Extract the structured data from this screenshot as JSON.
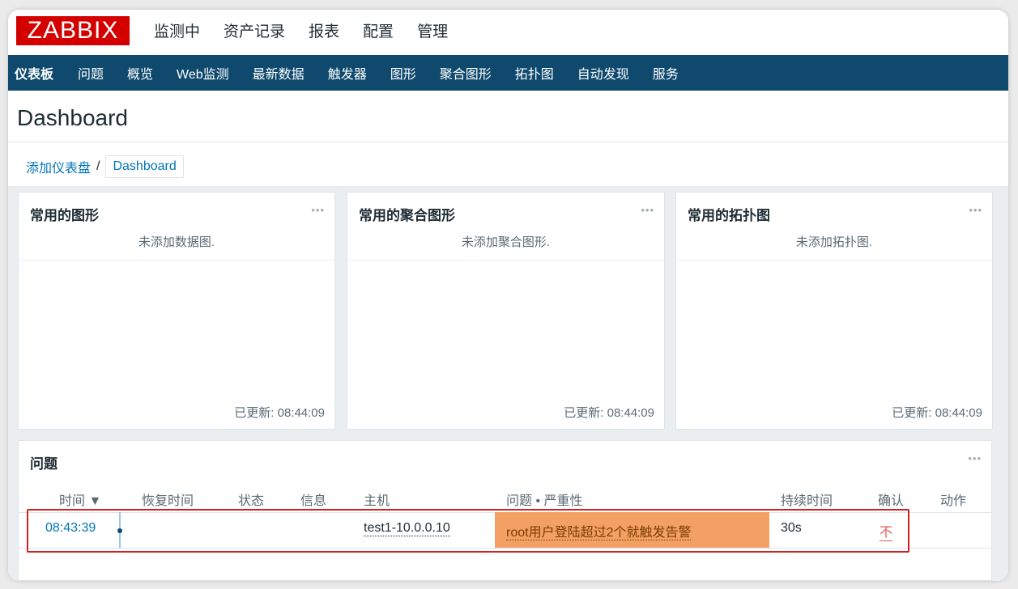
{
  "app": {
    "logo_text": "ZABBIX"
  },
  "top_menu": [
    "监测中",
    "资产记录",
    "报表",
    "配置",
    "管理"
  ],
  "sub_nav": [
    "仪表板",
    "问题",
    "概览",
    "Web监测",
    "最新数据",
    "触发器",
    "图形",
    "聚合图形",
    "拓扑图",
    "自动发现",
    "服务"
  ],
  "page": {
    "title": "Dashboard"
  },
  "breadcrumb": {
    "root": "添加仪表盘",
    "separator": "/",
    "current": "Dashboard"
  },
  "widgets": [
    {
      "title": "常用的图形",
      "empty_text": "未添加数据图.",
      "updated": "已更新: 08:44:09"
    },
    {
      "title": "常用的聚合图形",
      "empty_text": "未添加聚合图形.",
      "updated": "已更新: 08:44:09"
    },
    {
      "title": "常用的拓扑图",
      "empty_text": "未添加拓扑图.",
      "updated": "已更新: 08:44:09"
    }
  ],
  "widget_menu_icon": "•••",
  "problems": {
    "title": "问题",
    "columns": [
      "时间 ▼",
      "恢复时间",
      "状态",
      "信息",
      "主机",
      "问题 • 严重性",
      "持续时间",
      "确认",
      "动作"
    ],
    "rows": [
      {
        "time": "08:43:39",
        "recovery_time": "",
        "status": "",
        "info": "",
        "host": "test1-10.0.0.10",
        "problem": "root用户登陆超过2个就触发告警",
        "duration": "30s",
        "ack": "不",
        "actions": ""
      }
    ]
  },
  "colors": {
    "brand": "#d40000",
    "nav_bg": "#0f4a6e",
    "link": "#0275b8",
    "severity_average": "#f3a064",
    "highlight_border": "#d0231f"
  },
  "icons": {
    "widget_menu": "more-icon",
    "timeline_dot": "timeline-dot-icon"
  }
}
